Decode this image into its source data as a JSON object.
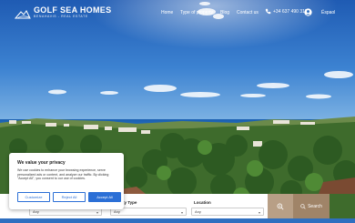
{
  "header": {
    "brand_name": "GOLF SEA HOMES",
    "brand_tagline": "BENAHAVIS - REAL ESTATE",
    "menu": [
      "Home",
      "Type of property",
      "Blog",
      "Contact us"
    ],
    "phone": "+34 637 490 312",
    "language": "Ёspaol"
  },
  "search": {
    "fields": [
      {
        "label": "",
        "value": "Any"
      },
      {
        "label": "ty Type",
        "value": "Any"
      },
      {
        "label": "Location",
        "value": "Any"
      }
    ],
    "search_label": "Search",
    "colors": {
      "filter": "#b89f86",
      "search": "#a08468"
    }
  },
  "cookie": {
    "title": "We value your privacy",
    "body": "We use cookies to enhance your browsing experience, serve personalized ads or content, and analyze our traffic. By clicking \"Accept All\", you consent to our use of cookies.",
    "customize_label": "Customize",
    "reject_label": "Reject All",
    "accept_label": "Accept All",
    "accent": "#2b6fd6"
  }
}
